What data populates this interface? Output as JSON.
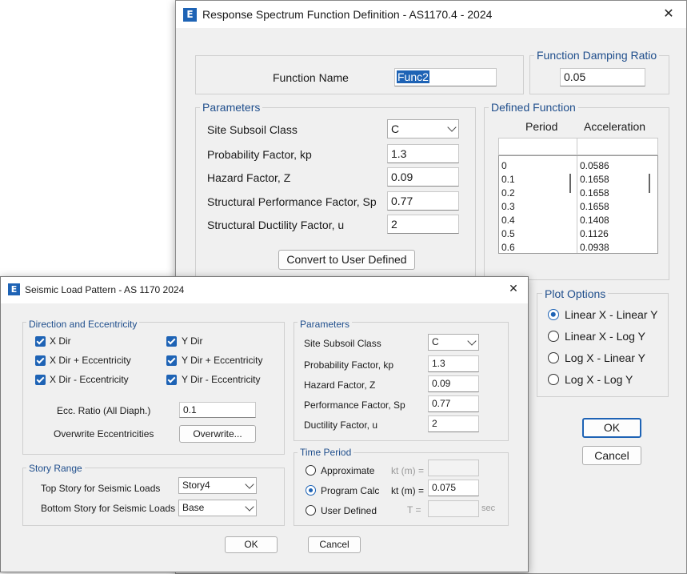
{
  "response_spectrum": {
    "title": "Response Spectrum Function Definition - AS1170.4 - 2024",
    "function_name_label": "Function Name",
    "function_name_value": "Func2",
    "damping_group": "Function Damping Ratio",
    "damping_value": "0.05",
    "parameters_group": "Parameters",
    "params": [
      {
        "label": "Site Subsoil Class",
        "value": "C"
      },
      {
        "label": "Probability Factor, kp",
        "value": "1.3"
      },
      {
        "label": "Hazard Factor, Z",
        "value": "0.09"
      },
      {
        "label": "Structural Performance Factor, Sp",
        "value": "0.77"
      },
      {
        "label": "Structural Ductility Factor, u",
        "value": "2"
      }
    ],
    "convert_button": "Convert to User Defined",
    "defined_group": "Defined Function",
    "col_period": "Period",
    "col_acceleration": "Acceleration",
    "periods": [
      "0",
      "0.1",
      "0.2",
      "0.3",
      "0.4",
      "0.5",
      "0.6"
    ],
    "accelerations": [
      "0.0586",
      "0.1658",
      "0.1658",
      "0.1658",
      "0.1408",
      "0.1126",
      "0.0938"
    ],
    "plot_group": "Plot Options",
    "plot_options": [
      "Linear X - Linear Y",
      "Linear X - Log Y",
      "Log X - Linear Y",
      "Log X - Log Y"
    ],
    "plot_selected": 0,
    "ok": "OK",
    "cancel": "Cancel"
  },
  "seismic": {
    "title": "Seismic Load Pattern - AS 1170 2024",
    "direction_group": "Direction and Eccentricity",
    "directions": [
      "X Dir",
      "Y Dir",
      "X Dir + Eccentricity",
      "Y Dir + Eccentricity",
      "X Dir - Eccentricity",
      "Y Dir - Eccentricity"
    ],
    "ecc_label": "Ecc. Ratio (All Diaph.)",
    "ecc_value": "0.1",
    "overwrite_label": "Overwrite Eccentricities",
    "overwrite_button": "Overwrite...",
    "story_group": "Story Range",
    "top_story_label": "Top Story for Seismic Loads",
    "top_story_value": "Story4",
    "bottom_story_label": "Bottom Story for Seismic Loads",
    "bottom_story_value": "Base",
    "parameters_group": "Parameters",
    "params": [
      {
        "label": "Site Subsoil Class",
        "value": "C"
      },
      {
        "label": "Probability Factor, kp",
        "value": "1.3"
      },
      {
        "label": "Hazard Factor, Z",
        "value": "0.09"
      },
      {
        "label": "Performance Factor, Sp",
        "value": "0.77"
      },
      {
        "label": "Ductility Factor, u",
        "value": "2"
      }
    ],
    "time_group": "Time Period",
    "time_options": [
      {
        "label": "Approximate",
        "field_label": "kt (m) =",
        "value": "",
        "suffix": ""
      },
      {
        "label": "Program Calc",
        "field_label": "kt (m) =",
        "value": "0.075",
        "suffix": ""
      },
      {
        "label": "User Defined",
        "field_label": "T =",
        "value": "",
        "suffix": "sec"
      }
    ],
    "time_selected": 1,
    "ok": "OK",
    "cancel": "Cancel"
  }
}
